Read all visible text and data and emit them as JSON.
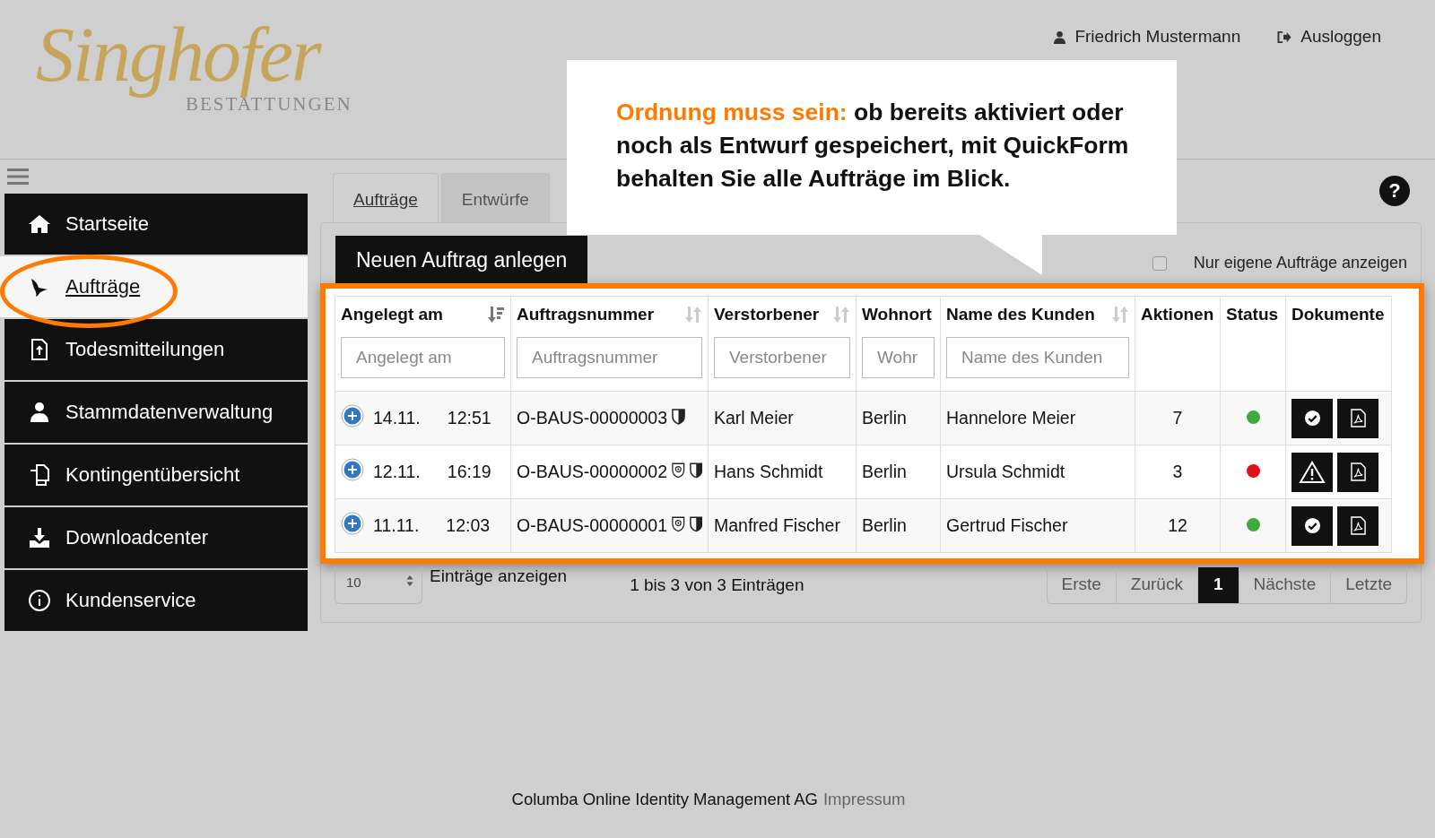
{
  "logo": {
    "script": "Singhofer",
    "sub": "BESTATTUNGEN"
  },
  "user": {
    "name": "Friedrich Mustermann",
    "logout": "Ausloggen"
  },
  "sidebar": {
    "items": [
      {
        "label": "Startseite",
        "selected": false
      },
      {
        "label": "Aufträge",
        "selected": true
      },
      {
        "label": "Todesmitteilungen",
        "selected": false
      },
      {
        "label": "Stammdatenverwaltung",
        "selected": false
      },
      {
        "label": "Kontingentübersicht",
        "selected": false
      },
      {
        "label": "Downloadcenter",
        "selected": false
      },
      {
        "label": "Kundenservice",
        "selected": false
      }
    ]
  },
  "tabs": [
    {
      "label": "Aufträge",
      "selected": true
    },
    {
      "label": "Entwürfe",
      "selected": false
    }
  ],
  "help": "?",
  "new_button": "Neuen Auftrag anlegen",
  "own_only": {
    "label": "Nur eigene Aufträge anzeigen",
    "checked": false
  },
  "table": {
    "columns": [
      {
        "label": "Angelegt am",
        "sort_icon": {
          "kind": "descending"
        },
        "placeholder": "Angelegt am"
      },
      {
        "label": "Auftragsnummer",
        "sort_icon": {
          "kind": "unsorted"
        },
        "placeholder": "Auftragsnummer"
      },
      {
        "label": "Verstorbener",
        "sort_icon": {
          "kind": "unsorted"
        },
        "placeholder": "Verstorbener"
      },
      {
        "label": "Wohnort",
        "placeholder": "Wohr"
      },
      {
        "label": "Name des Kunden",
        "sort_icon": {
          "kind": "unsorted"
        },
        "placeholder": "Name des Kunden"
      },
      {
        "label": "Aktionen"
      },
      {
        "label": "Status"
      },
      {
        "label": "Dokumente"
      }
    ],
    "rows": [
      {
        "date": "14.11.",
        "time": "12:51",
        "number": "O-BAUS-00000003",
        "badges": [
          {
            "kind": "shield"
          }
        ],
        "deceased": "Karl Meier",
        "city": "Berlin",
        "customer": "Hannelore Meier",
        "actions": "7",
        "status": {
          "color": "#3daa3d"
        },
        "document_button": {
          "kind": "check"
        }
      },
      {
        "date": "12.11.",
        "time": "16:19",
        "number": "O-BAUS-00000002",
        "badges": [
          {
            "kind": "mail"
          },
          {
            "kind": "shield"
          }
        ],
        "deceased": "Hans Schmidt",
        "city": "Berlin",
        "customer": "Ursula Schmidt",
        "actions": "3",
        "status": {
          "color": "#e0101a"
        },
        "document_button": {
          "kind": "warning"
        }
      },
      {
        "date": "11.11.",
        "time": "12:03",
        "number": "O-BAUS-00000001",
        "badges": [
          {
            "kind": "mail"
          },
          {
            "kind": "shield"
          }
        ],
        "deceased": "Manfred Fischer",
        "city": "Berlin",
        "customer": "Gertrud Fischer",
        "actions": "12",
        "status": {
          "color": "#3daa3d"
        },
        "document_button": {
          "kind": "check"
        }
      }
    ]
  },
  "pagination": {
    "page_size": "10",
    "page_size_label": "Einträge anzeigen",
    "info": "1 bis 3 von 3 Einträgen",
    "pages": [
      {
        "label": "Erste",
        "selected": false
      },
      {
        "label": "Zurück",
        "selected": false
      },
      {
        "label": "1",
        "selected": true
      },
      {
        "label": "Nächste",
        "selected": false
      },
      {
        "label": "Letzte",
        "selected": false
      }
    ]
  },
  "footer": {
    "text": "Columba Online Identity Management AG",
    "link": "Impressum"
  },
  "callout": {
    "lead": "Ordnung muss sein:",
    "text": "ob bereits aktiviert oder noch als Entwurf gespeichert, mit QuickForm behalten Sie alle Aufträge im Blick."
  }
}
